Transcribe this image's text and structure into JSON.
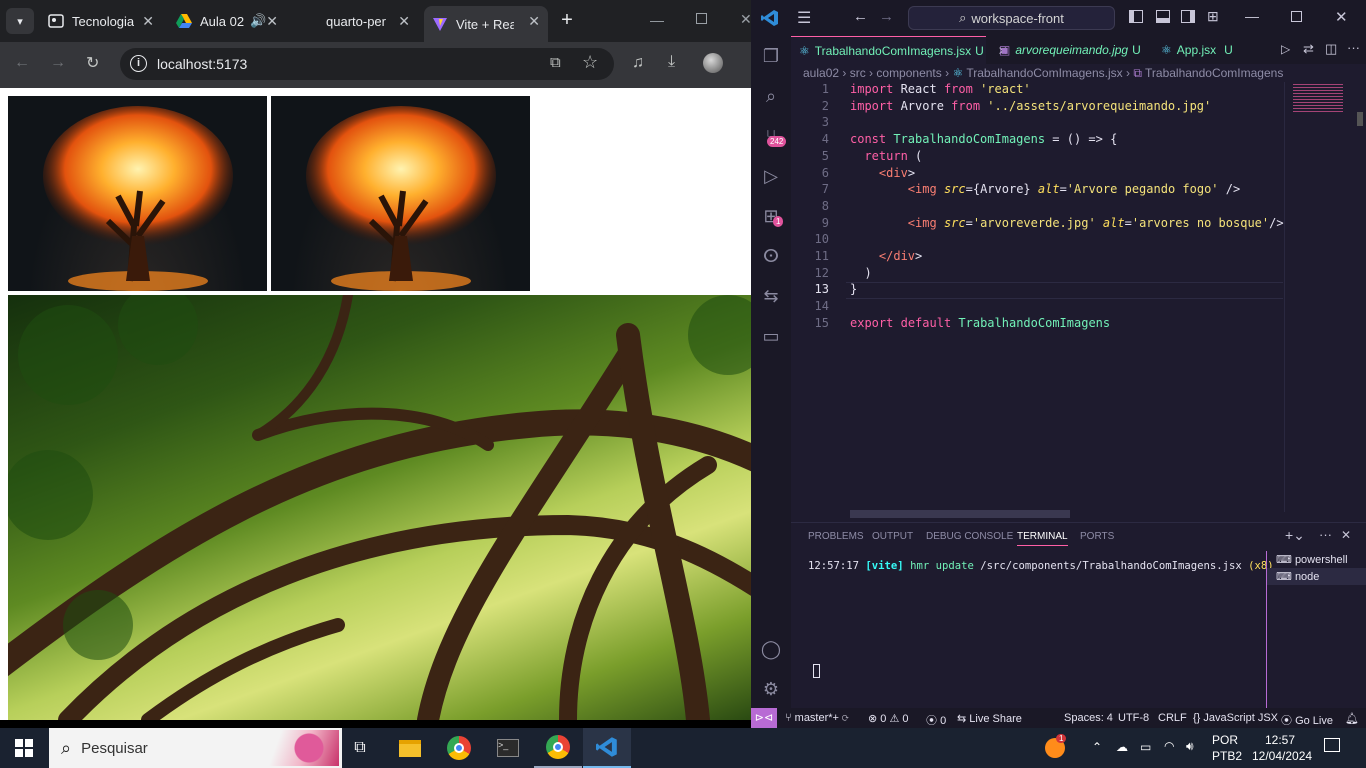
{
  "browser": {
    "tabs": [
      {
        "title": "Tecnologia",
        "icon": "page-icon"
      },
      {
        "title": "Aula 02",
        "icon": "drive-icon"
      },
      {
        "title": "quarto-per",
        "icon": "page-icon"
      },
      {
        "title": "Vite + React",
        "icon": "vite-icon"
      }
    ],
    "new_tab": "+",
    "url": "localhost:5173"
  },
  "page": {
    "images": [
      {
        "alt": "Arvore pegando fogo"
      },
      {
        "alt": "Arvore pegando fogo"
      },
      {
        "alt": "arvores no bosque"
      }
    ]
  },
  "vscode": {
    "search": "workspace-front",
    "tabs": [
      {
        "label": "TrabalhandoComImagens.jsx",
        "status": "U",
        "color": "#72f1b8"
      },
      {
        "label": "arvorequeimando.jpg",
        "status": "U",
        "color": "#72f1b8"
      },
      {
        "label": "App.jsx",
        "status": "U",
        "color": "#72f1b8"
      }
    ],
    "breadcrumb": [
      "aula02",
      "src",
      "components",
      "TrabalhandoComImagens.jsx",
      "TrabalhandoComImagens"
    ],
    "line_numbers": [
      "1",
      "2",
      "3",
      "4",
      "5",
      "6",
      "7",
      "8",
      "9",
      "10",
      "11",
      "12",
      "13",
      "14",
      "15"
    ],
    "code": [
      "import React from 'react'",
      "import Arvore from '../assets/arvorequeimando.jpg'",
      "",
      "const TrabalhandoComImagens = () => {",
      "  return (",
      "    <div>",
      "        <img src={Arvore} alt='Arvore pegando fogo' />",
      "",
      "        <img src='arvoreverde.jpg' alt='arvores no bosque'/>",
      "",
      "    </div>",
      "  )",
      "}",
      "",
      "export default TrabalhandoComImagens"
    ],
    "activity_badges": {
      "source_control": "242",
      "extensions": "1"
    },
    "panel_tabs": [
      "PROBLEMS",
      "OUTPUT",
      "DEBUG CONSOLE",
      "TERMINAL",
      "PORTS"
    ],
    "terminal_line": {
      "time": "12:57:17",
      "tag": "[vite]",
      "action": "hmr update",
      "path": "/src/components/TrabalhandoComImagens.jsx",
      "count": "(x8)"
    },
    "terminals": [
      "powershell",
      "node"
    ],
    "status": {
      "branch": "master*+",
      "errors": "0",
      "warnings": "0",
      "ports": "0",
      "liveshare": "Live Share",
      "spaces": "Spaces: 4",
      "encoding": "UTF-8",
      "eol": "CRLF",
      "language": "JavaScript JSX",
      "golive": "Go Live"
    }
  },
  "taskbar": {
    "search": "Pesquisar",
    "lang1": "POR",
    "lang2": "PTB2",
    "time": "12:57",
    "date": "12/04/2024",
    "notif": "1"
  }
}
